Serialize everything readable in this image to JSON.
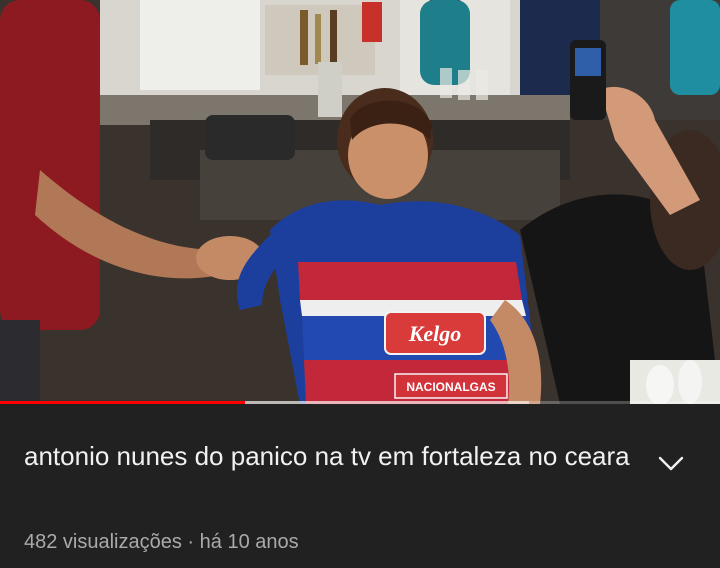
{
  "video": {
    "title": "antonio nunes do panico na tv em fortaleza no ceara",
    "progress_played": 0.34,
    "progress_buffered": 0.735,
    "jersey_text": {
      "sponsor": "Kelgo",
      "sleeve_sponsor": "NACIONALGAS"
    }
  },
  "meta": {
    "views": "482 visualizações",
    "separator": " · ",
    "age": "há 10 anos"
  },
  "icons": {
    "expand": "chevron-down-icon"
  },
  "colors": {
    "background": "#212121",
    "title": "#f1f1f1",
    "meta": "#aaaaaa",
    "progress_played": "#ff0000"
  }
}
